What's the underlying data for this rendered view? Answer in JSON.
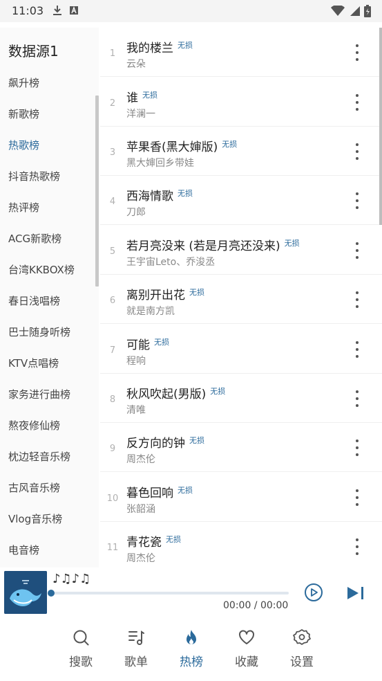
{
  "status": {
    "time": "11:03"
  },
  "sidebar": {
    "title": "数据源1",
    "items": [
      {
        "label": "飙升榜",
        "active": false
      },
      {
        "label": "新歌榜",
        "active": false
      },
      {
        "label": "热歌榜",
        "active": true
      },
      {
        "label": "抖音热歌榜",
        "active": false
      },
      {
        "label": "热评榜",
        "active": false
      },
      {
        "label": "ACG新歌榜",
        "active": false
      },
      {
        "label": "台湾KKBOX榜",
        "active": false
      },
      {
        "label": "春日浅唱榜",
        "active": false
      },
      {
        "label": "巴士随身听榜",
        "active": false
      },
      {
        "label": "KTV点唱榜",
        "active": false
      },
      {
        "label": "家务进行曲榜",
        "active": false
      },
      {
        "label": "熬夜修仙榜",
        "active": false
      },
      {
        "label": "枕边轻音乐榜",
        "active": false
      },
      {
        "label": "古风音乐榜",
        "active": false
      },
      {
        "label": "Vlog音乐榜",
        "active": false
      },
      {
        "label": "电音榜",
        "active": false
      }
    ]
  },
  "songs": [
    {
      "num": "1",
      "name": "我的楼兰",
      "badge": "无损",
      "artist": "云朵"
    },
    {
      "num": "2",
      "name": "谁",
      "badge": "无损",
      "artist": "洋澜一"
    },
    {
      "num": "3",
      "name": "苹果香(黑大婶版)",
      "badge": "无损",
      "artist": "黑大婶回乡带娃"
    },
    {
      "num": "4",
      "name": "西海情歌",
      "badge": "无损",
      "artist": "刀郎"
    },
    {
      "num": "5",
      "name": "若月亮没来 (若是月亮还没来)",
      "badge": "无损",
      "artist": "王宇宙Leto、乔浚丞"
    },
    {
      "num": "6",
      "name": "离别开出花",
      "badge": "无损",
      "artist": "就是南方凯"
    },
    {
      "num": "7",
      "name": "可能",
      "badge": "无损",
      "artist": "程响"
    },
    {
      "num": "8",
      "name": "秋风吹起(男版)",
      "badge": "无损",
      "artist": "清唯"
    },
    {
      "num": "9",
      "name": "反方向的钟",
      "badge": "无损",
      "artist": "周杰伦"
    },
    {
      "num": "10",
      "name": "暮色回响",
      "badge": "无损",
      "artist": "张韶涵"
    },
    {
      "num": "11",
      "name": "青花瓷",
      "badge": "无损",
      "artist": "周杰伦"
    }
  ],
  "player": {
    "title": "♪♫♪♫",
    "time": "00:00 / 00:00",
    "progress": 0
  },
  "tabs": [
    {
      "label": "搜歌",
      "icon": "search-icon",
      "active": false
    },
    {
      "label": "歌单",
      "icon": "playlist-icon",
      "active": false
    },
    {
      "label": "热榜",
      "icon": "flame-icon",
      "active": true
    },
    {
      "label": "收藏",
      "icon": "heart-icon",
      "active": false
    },
    {
      "label": "设置",
      "icon": "gear-icon",
      "active": false
    }
  ],
  "colors": {
    "accent": "#2b6a9b",
    "text": "#222222",
    "muted": "#888888"
  }
}
